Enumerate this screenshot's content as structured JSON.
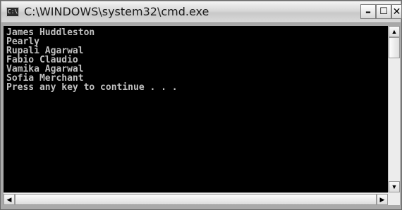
{
  "window": {
    "title": "C:\\WINDOWS\\system32\\cmd.exe",
    "icon_label": "C:\\",
    "controls": {
      "minimize": "minimize-icon",
      "maximize": "maximize-icon",
      "close": "close-icon"
    }
  },
  "console": {
    "lines": [
      "James Huddleston",
      "Pearly",
      "Rupali Agarwal",
      "Fabio Claudio",
      "Vamika Agarwal",
      "Sofia Merchant",
      "Press any key to continue . . ."
    ],
    "text_color": "#c0c0c0",
    "background": "#000000"
  },
  "scrollbars": {
    "vertical": {
      "up": "scroll-up-arrow-icon",
      "down": "scroll-down-arrow-icon"
    },
    "horizontal": {
      "left": "scroll-left-arrow-icon",
      "right": "scroll-right-arrow-icon"
    }
  }
}
